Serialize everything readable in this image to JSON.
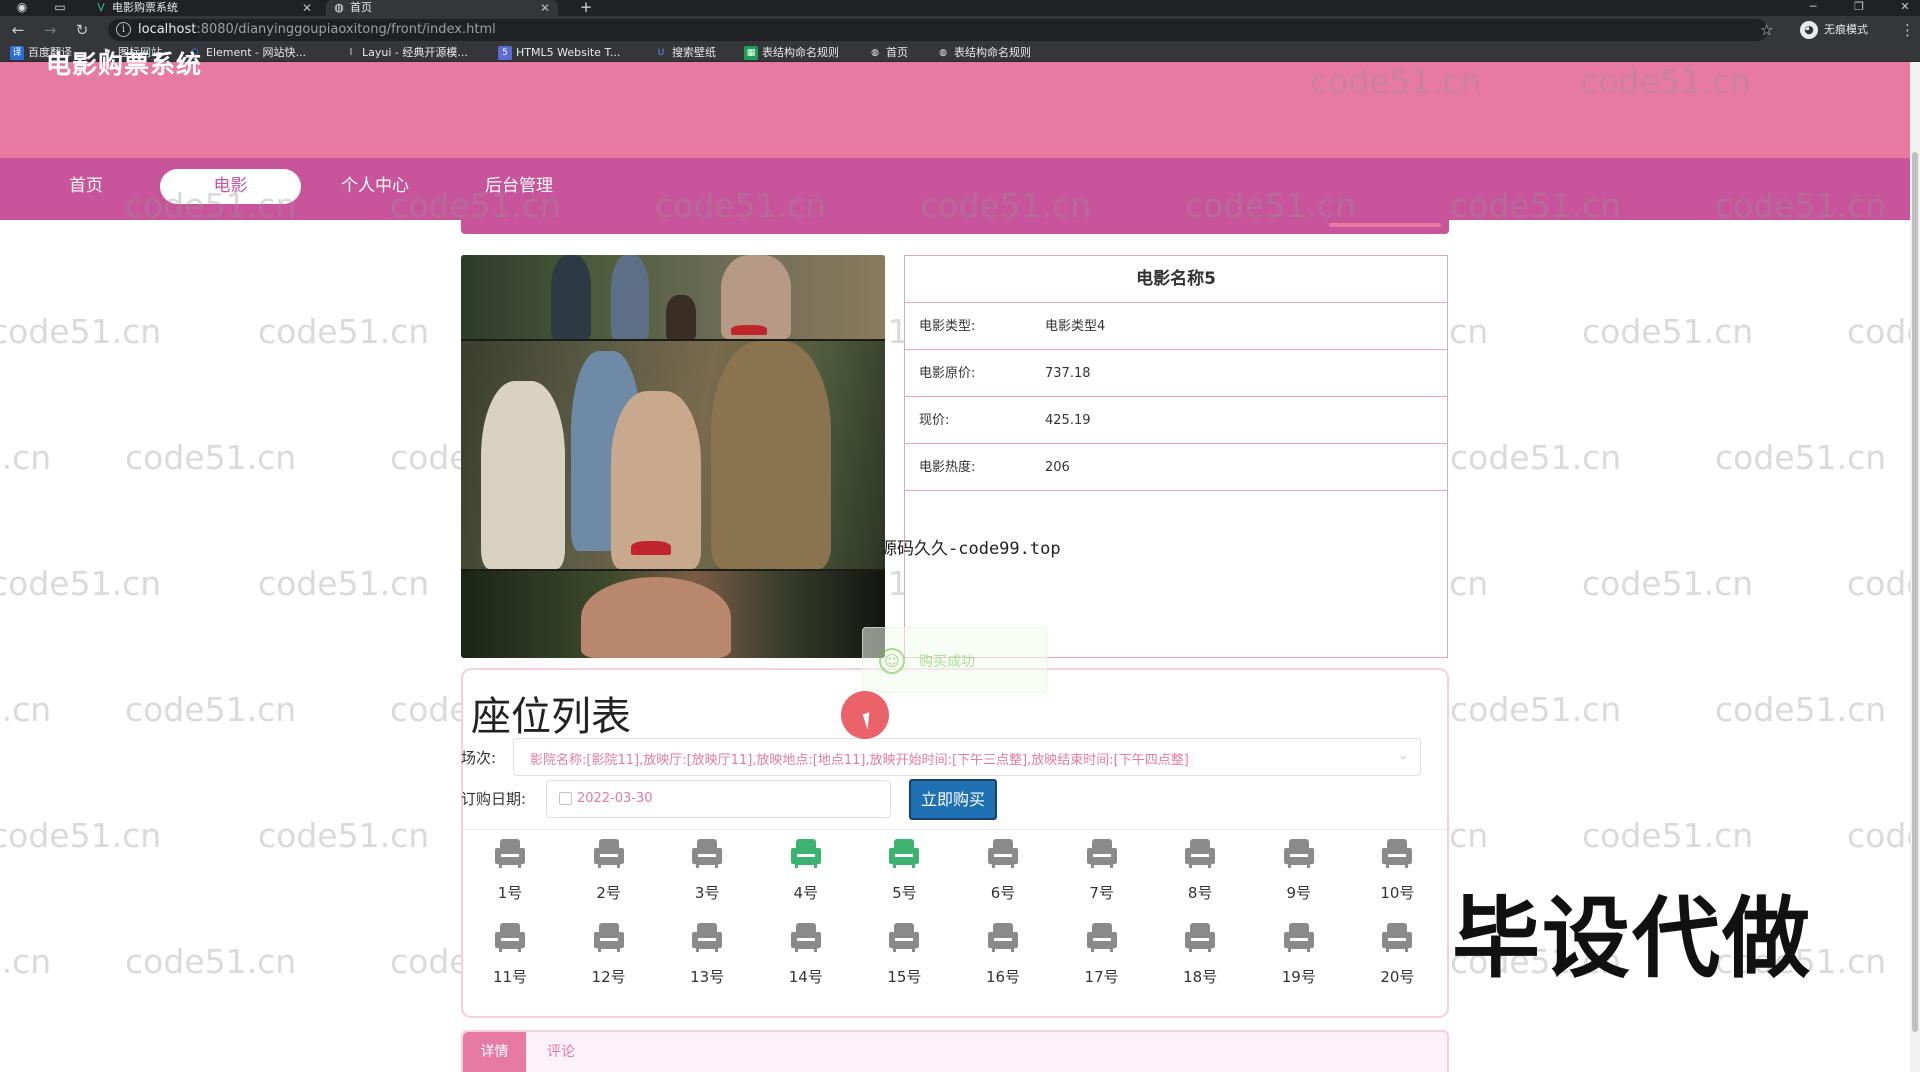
{
  "browser": {
    "tabs": [
      {
        "title": "电影购票系统",
        "icon": "vue-icon"
      },
      {
        "title": "首页",
        "icon": "globe-icon"
      }
    ],
    "url_host": "localhost",
    "url_rest": ":8080/dianyinggoupiaoxitong/front/index.html",
    "incognito_label": "无痕模式",
    "bookmarks": [
      "百度翻译",
      "图标网站",
      "Element - 网站快...",
      "Layui - 经典开源模...",
      "HTML5 Website T...",
      "搜索壁纸",
      "表结构命名规则",
      "首页",
      "表结构命名规则"
    ]
  },
  "app": {
    "title": "电影购票系统",
    "nav": [
      {
        "label": "首页",
        "active": false
      },
      {
        "label": "电影",
        "active": true
      },
      {
        "label": "个人中心",
        "active": false
      },
      {
        "label": "后台管理",
        "active": false
      }
    ],
    "accent_color": "#e77aa0",
    "nav_color": "#c8559c"
  },
  "movie": {
    "name": "电影名称5",
    "rows": [
      {
        "label": "电影类型:",
        "value": "电影类型4"
      },
      {
        "label": "电影原价:",
        "value": "737.18"
      },
      {
        "label": "现价:",
        "value": "425.19"
      },
      {
        "label": "电影热度:",
        "value": "206"
      }
    ]
  },
  "overlay_text": "源码久久-code99.top",
  "toast": {
    "message": "购买成功",
    "color": "#67c23a"
  },
  "seats": {
    "heading": "座位列表",
    "session_label": "场次:",
    "session_value": "影院名称:[影院11],放映厅:[放映厅11],放映地点:[地点11],放映开始时间:[下午三点整],放映结束时间:[下午四点整]",
    "date_label": "订购日期:",
    "date_value": "2022-03-30",
    "buy_button": "立即购买",
    "list": [
      {
        "label": "1号",
        "sold": false
      },
      {
        "label": "2号",
        "sold": false
      },
      {
        "label": "3号",
        "sold": false
      },
      {
        "label": "4号",
        "sold": true
      },
      {
        "label": "5号",
        "sold": true
      },
      {
        "label": "6号",
        "sold": false
      },
      {
        "label": "7号",
        "sold": false
      },
      {
        "label": "8号",
        "sold": false
      },
      {
        "label": "9号",
        "sold": false
      },
      {
        "label": "10号",
        "sold": false
      },
      {
        "label": "11号",
        "sold": false
      },
      {
        "label": "12号",
        "sold": false
      },
      {
        "label": "13号",
        "sold": false
      },
      {
        "label": "14号",
        "sold": false
      },
      {
        "label": "15号",
        "sold": false
      },
      {
        "label": "16号",
        "sold": false
      },
      {
        "label": "17号",
        "sold": false
      },
      {
        "label": "18号",
        "sold": false
      },
      {
        "label": "19号",
        "sold": false
      },
      {
        "label": "20号",
        "sold": false
      }
    ],
    "sold_color": "#3cb371",
    "free_color": "#8a8a8a"
  },
  "ad_text": "毕设代做",
  "watermark": "code51.cn",
  "bottom_tabs": [
    {
      "label": "详情",
      "active": true
    },
    {
      "label": "评论",
      "active": false
    }
  ]
}
